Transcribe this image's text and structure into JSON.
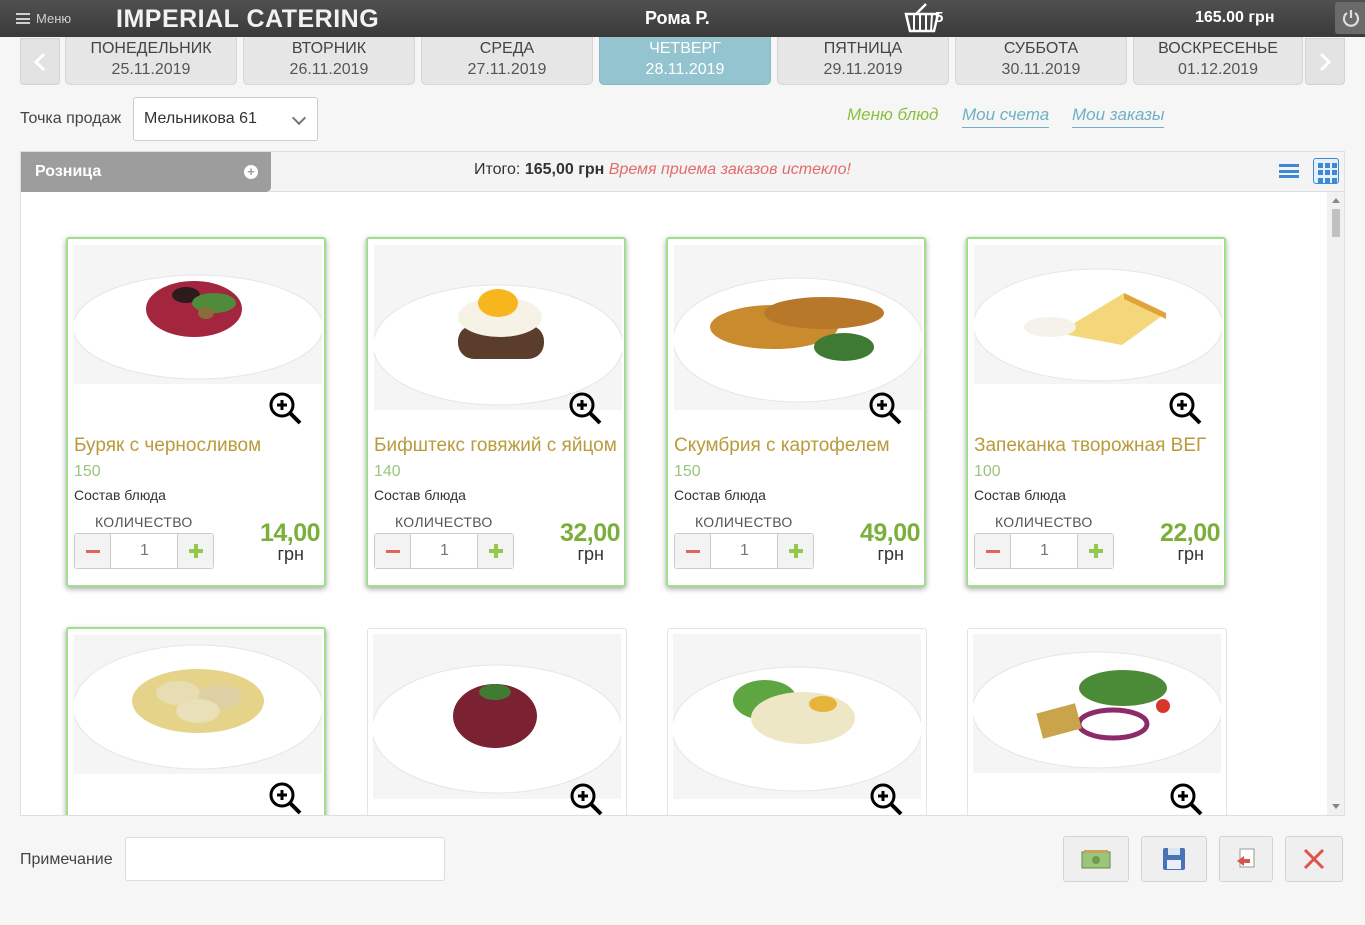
{
  "topbar": {
    "menu_label": "Меню",
    "brand": "IMPERIAL CATERING",
    "user": "Рома Р.",
    "cart_count": "5",
    "total": "165.00 грн"
  },
  "days": [
    {
      "name": "ПОНЕДЕЛЬНИК",
      "date": "25.11.2019",
      "active": false
    },
    {
      "name": "ВТОРНИК",
      "date": "26.11.2019",
      "active": false
    },
    {
      "name": "СРЕДА",
      "date": "27.11.2019",
      "active": false
    },
    {
      "name": "ЧЕТВЕРГ",
      "date": "28.11.2019",
      "active": true
    },
    {
      "name": "ПЯТНИЦА",
      "date": "29.11.2019",
      "active": false
    },
    {
      "name": "СУББОТА",
      "date": "30.11.2019",
      "active": false
    },
    {
      "name": "ВОСКРЕСЕНЬЕ",
      "date": "01.12.2019",
      "active": false
    }
  ],
  "sales_point": {
    "label": "Точка продаж",
    "value": "Мельникова 61"
  },
  "links": {
    "menu": "Меню блюд",
    "bills": "Мои счета",
    "orders": "Мои заказы"
  },
  "category": {
    "name": "Розница",
    "total_label": "Итого:",
    "total_value": "165,00 грн",
    "warning": "Время приема заказов истекло!"
  },
  "qty_label": "КОЛИЧЕСТВО",
  "composition_label": "Состав блюда",
  "currency": "грн",
  "products": [
    {
      "name": "Буряк с черносливом",
      "weight": "150",
      "qty": "1",
      "price": "14,00",
      "selected": true
    },
    {
      "name": "Бифштекс говяжий с яйцом",
      "weight": "140",
      "qty": "1",
      "price": "32,00",
      "selected": true
    },
    {
      "name": "Скумбрия с картофелем",
      "weight": "150",
      "qty": "1",
      "price": "49,00",
      "selected": true
    },
    {
      "name": "Запеканка творожная ВЕГ",
      "weight": "100",
      "qty": "1",
      "price": "22,00",
      "selected": true
    }
  ],
  "note": {
    "label": "Примечание",
    "value": ""
  },
  "icons": {
    "menu": "hamburger-icon",
    "cart": "basket-icon",
    "power": "power-icon",
    "zoom": "zoom-in-icon",
    "pay": "money-icon",
    "save": "floppy-disk-icon",
    "return": "return-icon",
    "cancel": "cancel-x-icon"
  },
  "colors": {
    "active_day": "#93c4cf",
    "dish_name": "#b99a3c",
    "price": "#7bae3a",
    "warning": "#e46b6b",
    "link_active": "#8cbf3f",
    "link": "#6fb0c4"
  }
}
